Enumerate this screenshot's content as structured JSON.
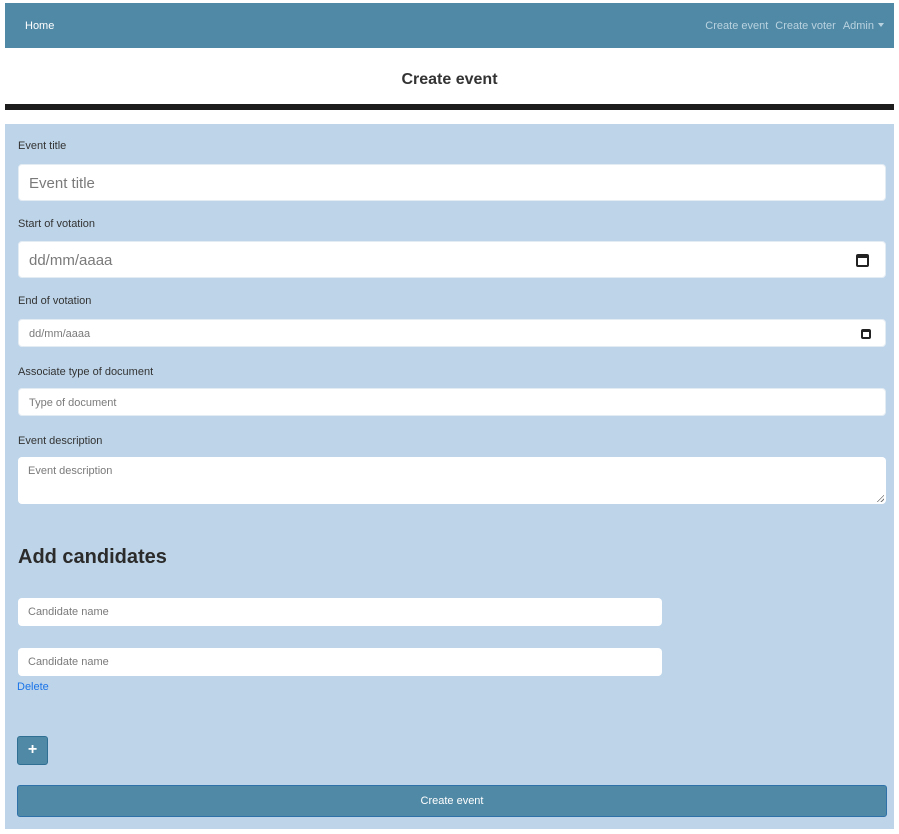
{
  "navbar": {
    "home_label": "Home",
    "create_event_label": "Create event",
    "create_voter_label": "Create voter",
    "admin_label": "Admin",
    "caret_icon": "caret-down-icon",
    "background_color": "#5089a5"
  },
  "page": {
    "title": "Create event"
  },
  "form": {
    "event_title": {
      "label": "Event title",
      "placeholder": "Event title"
    },
    "start_date": {
      "label": "Start of votation",
      "placeholder": "dd/mm/aaaa",
      "icon": "calendar-icon"
    },
    "end_date": {
      "label": "End of votation",
      "placeholder": "dd/mm/aaaa",
      "icon": "calendar-icon"
    },
    "document_type": {
      "label": "Associate type of document",
      "placeholder": "Type of document"
    },
    "description": {
      "label": "Event description",
      "placeholder": "Event description"
    },
    "panel_color": "#bed5e9"
  },
  "candidates": {
    "section_title": "Add candidates",
    "items": [
      {
        "placeholder": "Candidate name"
      },
      {
        "placeholder": "Candidate name",
        "delete_label": "Delete"
      }
    ],
    "add_button_symbol": "+",
    "add_button_icon": "plus-icon"
  },
  "submit": {
    "label": "Create event"
  }
}
